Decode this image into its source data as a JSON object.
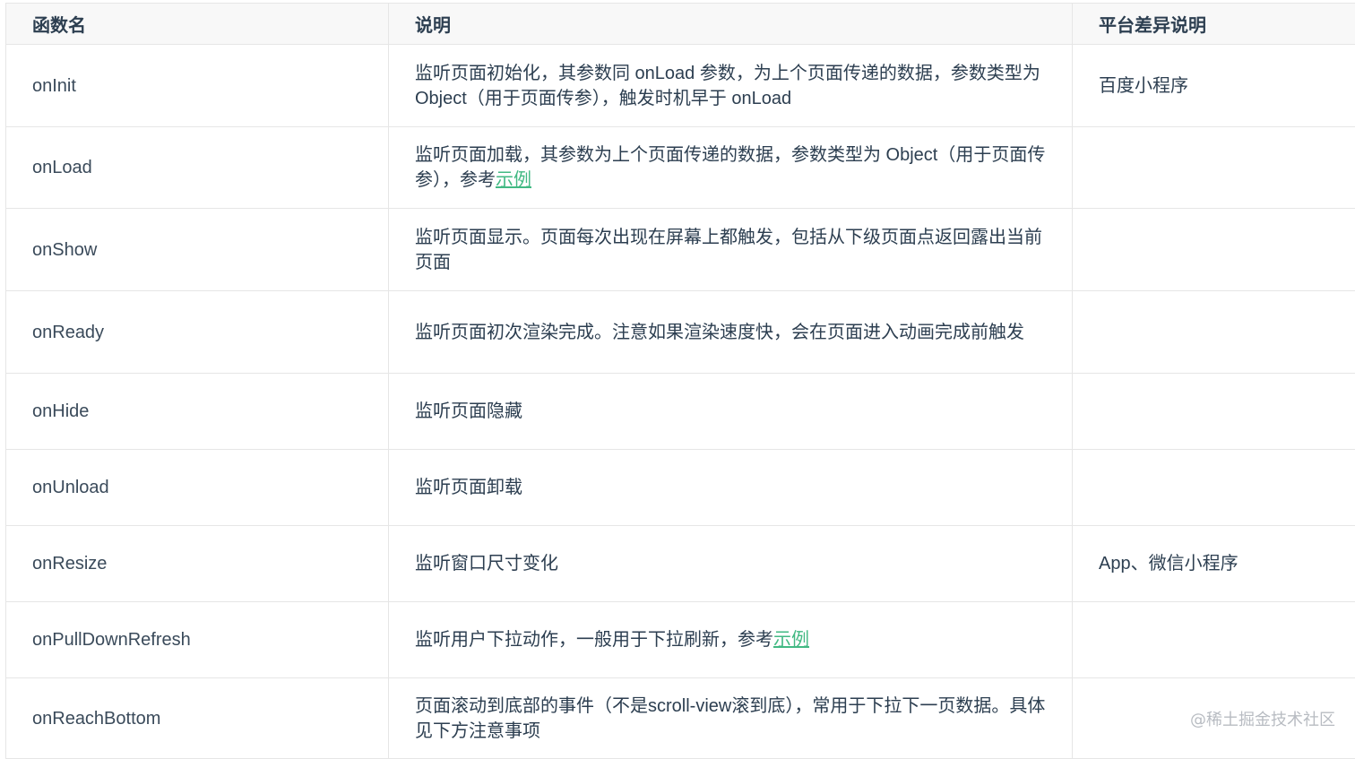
{
  "headers": {
    "name": "函数名",
    "desc": "说明",
    "platform": "平台差异说明"
  },
  "rows": [
    {
      "name": "onInit",
      "desc": "监听页面初始化，其参数同 onLoad 参数，为上个页面传递的数据，参数类型为 Object（用于页面传参），触发时机早于 onLoad",
      "link": "",
      "platform": "百度小程序"
    },
    {
      "name": "onLoad",
      "desc": "监听页面加载，其参数为上个页面传递的数据，参数类型为 Object（用于页面传参），参考",
      "link": "示例",
      "platform": ""
    },
    {
      "name": "onShow",
      "desc": "监听页面显示。页面每次出现在屏幕上都触发，包括从下级页面点返回露出当前页面",
      "link": "",
      "platform": ""
    },
    {
      "name": "onReady",
      "desc": "监听页面初次渲染完成。注意如果渲染速度快，会在页面进入动画完成前触发",
      "link": "",
      "platform": ""
    },
    {
      "name": "onHide",
      "desc": "监听页面隐藏",
      "link": "",
      "platform": ""
    },
    {
      "name": "onUnload",
      "desc": "监听页面卸载",
      "link": "",
      "platform": ""
    },
    {
      "name": "onResize",
      "desc": "监听窗口尺寸变化",
      "link": "",
      "platform": "App、微信小程序"
    },
    {
      "name": "onPullDownRefresh",
      "desc": "监听用户下拉动作，一般用于下拉刷新，参考",
      "link": "示例",
      "platform": ""
    },
    {
      "name": "onReachBottom",
      "desc": "页面滚动到底部的事件（不是scroll-view滚到底），常用于下拉下一页数据。具体见下方注意事项",
      "link": "",
      "platform": ""
    }
  ],
  "watermark": "@稀土掘金技术社区"
}
